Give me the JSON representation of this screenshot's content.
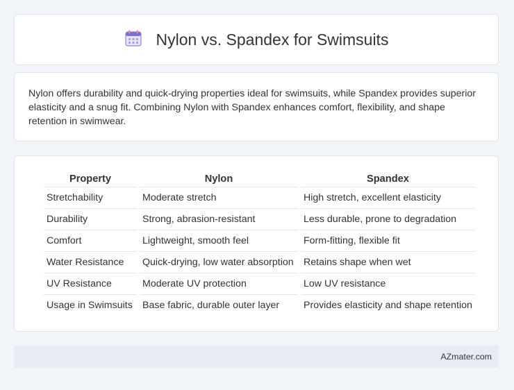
{
  "header": {
    "icon": "calendar-icon",
    "title": "Nylon vs. Spandex for Swimsuits"
  },
  "summary": {
    "text": "Nylon offers durability and quick-drying properties ideal for swimsuits, while Spandex provides superior elasticity and a snug fit. Combining Nylon with Spandex enhances comfort, flexibility, and shape retention in swimwear."
  },
  "table": {
    "headers": [
      "Property",
      "Nylon",
      "Spandex"
    ],
    "rows": [
      [
        "Stretchability",
        "Moderate stretch",
        "High stretch, excellent elasticity"
      ],
      [
        "Durability",
        "Strong, abrasion-resistant",
        "Less durable, prone to degradation"
      ],
      [
        "Comfort",
        "Lightweight, smooth feel",
        "Form-fitting, flexible fit"
      ],
      [
        "Water Resistance",
        "Quick-drying, low water absorption",
        "Retains shape when wet"
      ],
      [
        "UV Resistance",
        "Moderate UV protection",
        "Low UV resistance"
      ],
      [
        "Usage in Swimsuits",
        "Base fabric, durable outer layer",
        "Provides elasticity and shape retention"
      ]
    ]
  },
  "footer": {
    "text": "AZmater.com"
  },
  "colors": {
    "background": "#f1f4f9",
    "card": "#ffffff",
    "footer": "#e7ecf4",
    "icon_accent": "#7b6fd6"
  }
}
